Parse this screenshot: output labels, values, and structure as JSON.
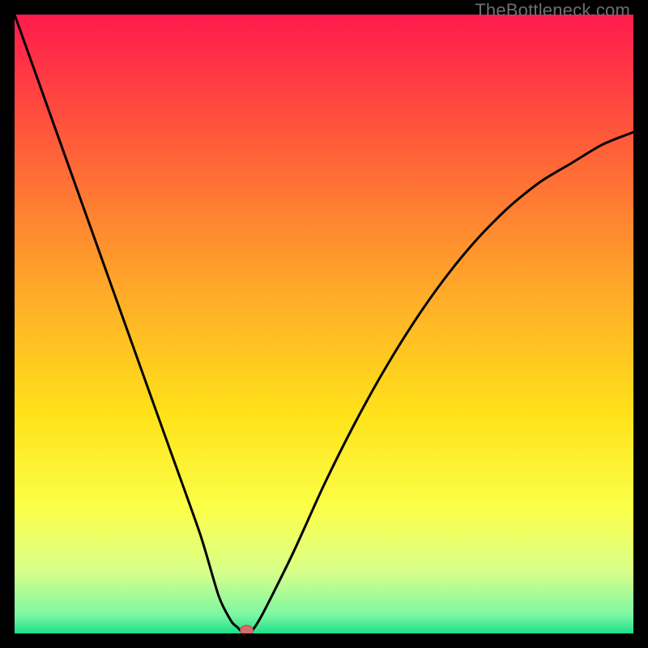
{
  "watermark": "TheBottleneck.com",
  "chart_data": {
    "type": "line",
    "title": "",
    "xlabel": "",
    "ylabel": "",
    "xlim": [
      0,
      100
    ],
    "ylim": [
      0,
      100
    ],
    "x": [
      0,
      5,
      10,
      15,
      20,
      25,
      30,
      33,
      35,
      36,
      37,
      38,
      40,
      45,
      50,
      55,
      60,
      65,
      70,
      75,
      80,
      85,
      90,
      95,
      100
    ],
    "values": [
      100,
      86,
      72,
      58,
      44,
      30,
      16,
      6,
      2,
      1,
      0,
      0,
      3,
      13,
      24,
      34,
      43,
      51,
      58,
      64,
      69,
      73,
      76,
      79,
      81
    ],
    "marker": {
      "x": 37.5,
      "y": 0
    },
    "gradient_stops": [
      {
        "pos": 0.0,
        "color": "#ff1a4d"
      },
      {
        "pos": 0.2,
        "color": "#ff5a3a"
      },
      {
        "pos": 0.45,
        "color": "#ffab28"
      },
      {
        "pos": 0.65,
        "color": "#ffe31a"
      },
      {
        "pos": 0.8,
        "color": "#fbff4a"
      },
      {
        "pos": 0.9,
        "color": "#d8ff8a"
      },
      {
        "pos": 0.97,
        "color": "#7cf7a3"
      },
      {
        "pos": 1.0,
        "color": "#1ee08a"
      }
    ]
  }
}
